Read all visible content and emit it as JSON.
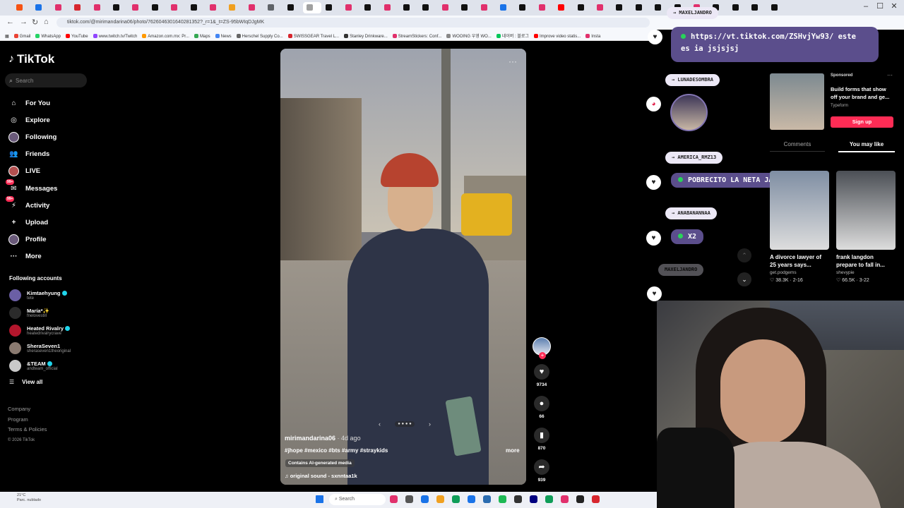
{
  "browser": {
    "tab_colors": [
      "#f65314",
      "#1a73e8",
      "#e1306c",
      "#d7262e",
      "#e1306c",
      "#111111",
      "#e1306c",
      "#111111",
      "#e1306c",
      "#111111",
      "#e1306c",
      "#f0a020",
      "#e1306c",
      "#5f6368",
      "#111111",
      "#a0a0a0",
      "#111111",
      "#e1306c",
      "#111111",
      "#e1306c",
      "#111111",
      "#111111",
      "#e1306c",
      "#111111",
      "#e1306c",
      "#1a73e8",
      "#111111",
      "#e1306c",
      "#ff0000",
      "#111111",
      "#e1306c",
      "#111111",
      "#111111",
      "#111111",
      "#111111",
      "#e1306c",
      "#111111",
      "#111111",
      "#111111",
      "#111111"
    ],
    "url": "tiktok.com/@mirimandarina06/photo/7626046301640281352?_r=1&_t=ZS-95bWIqDJgMK",
    "bookmarks": [
      {
        "label": "Gmail",
        "color": "#ea4335"
      },
      {
        "label": "WhatsApp",
        "color": "#25d366"
      },
      {
        "label": "YouTube",
        "color": "#ff0000"
      },
      {
        "label": "www.twitch.tv/Twitch",
        "color": "#9146ff"
      },
      {
        "label": "Amazon.com.mx: Pr...",
        "color": "#ff9900"
      },
      {
        "label": "Maps",
        "color": "#34a853"
      },
      {
        "label": "News",
        "color": "#4285f4"
      },
      {
        "label": "Herschel Supply Co...",
        "color": "#666666"
      },
      {
        "label": "SWISSGEAR Travel L...",
        "color": "#d7262e"
      },
      {
        "label": "Stanley Drinkware...",
        "color": "#333333"
      },
      {
        "label": "StreamStickers: Conf...",
        "color": "#e1306c"
      },
      {
        "label": "WOOING 우영 WO...",
        "color": "#888888"
      },
      {
        "label": "네이버 : 블로그",
        "color": "#03c75a"
      },
      {
        "label": "Improve video statis...",
        "color": "#ff0000"
      },
      {
        "label": "Insta",
        "color": "#e1306c"
      }
    ]
  },
  "sidebar": {
    "logo": "TikTok",
    "search_placeholder": "Search",
    "nav": [
      {
        "label": "For You",
        "icon": "home-icon",
        "glyph": "⌂"
      },
      {
        "label": "Explore",
        "icon": "compass-icon",
        "glyph": "◎"
      },
      {
        "label": "Following",
        "icon": "following-avatar",
        "glyph": ""
      },
      {
        "label": "Friends",
        "icon": "friends-icon",
        "glyph": "👥"
      },
      {
        "label": "LIVE",
        "icon": "live-avatar",
        "glyph": ""
      },
      {
        "label": "Messages",
        "icon": "messages-icon",
        "glyph": "✉",
        "badge": "99+"
      },
      {
        "label": "Activity",
        "icon": "activity-icon",
        "glyph": "⚡",
        "badge": "99+"
      },
      {
        "label": "Upload",
        "icon": "upload-icon",
        "glyph": "+"
      },
      {
        "label": "Profile",
        "icon": "profile-avatar",
        "glyph": ""
      },
      {
        "label": "More",
        "icon": "more-icon",
        "glyph": "···"
      }
    ],
    "following_title": "Following accounts",
    "following": [
      {
        "name": "Kimtaehyung",
        "handle": "tete",
        "verified": true,
        "color": "#6b5fa5"
      },
      {
        "name": "María*✨",
        "handle": "fnelovestill",
        "verified": false,
        "color": "#2b2b2b"
      },
      {
        "name": "Heated Rivalry",
        "handle": "heatedrivalrycrave",
        "verified": true,
        "color": "#b3162c"
      },
      {
        "name": "SheraSeven1",
        "handle": "sheraseven1theoriginal",
        "verified": false,
        "color": "#8a7a70"
      },
      {
        "name": "&TEAM",
        "handle": "andteam_official",
        "verified": true,
        "color": "#c9c9c9"
      }
    ],
    "view_all": "View all",
    "footer": [
      "Company",
      "Program",
      "Terms & Policies"
    ],
    "copyright": "© 2026 TikTok"
  },
  "video": {
    "author": "mirimandarina06",
    "age": "· 4d ago",
    "hashtags": "#jhope #mexico #bts #army #straykids",
    "more": "more",
    "ai_label": "Contains AI-generated media",
    "sound": "♫  original sound - sxnntaa1k",
    "menu": "···",
    "carousel_prev": "‹",
    "carousel_next": "›",
    "carousel_dots": "● ● ● ●"
  },
  "actions": {
    "likes": "9734",
    "comments": "66",
    "saves": "870",
    "shares": "939"
  },
  "chat": {
    "link_user": "→ MAXELJANDRO",
    "link_msg": "https://vt.tiktok.com/ZSHvjYw93/ este es ia jsjsjsj",
    "user1": "→ LUNADESOMBRA",
    "user2": "→ AMERICA_RMZ13",
    "msg2": "POBRECITO LA NETA JAJAJAJAJAJA",
    "user3": "→ ANABANANNAA",
    "msg3": "X2",
    "user4": "MAXELJANDRO"
  },
  "right_panel": {
    "sponsored": "Sponsored",
    "ad_text": "Build forms that show off your brand and ge...",
    "ad_brand": "Typeform",
    "signup": "Sign up",
    "tab_comments": "Comments",
    "tab_may_like": "You may like",
    "recs": [
      {
        "title": "A divorce lawyer of 25 years says...",
        "user": "get.podgems",
        "stats": "♡ 38.3K · 2-16",
        "color": "#7f8ea3"
      },
      {
        "title": "frank langdon prepare to fall in...",
        "user": "shevypie",
        "stats": "♡ 66.5K · 3-22",
        "color": "#4b4f55"
      }
    ]
  },
  "taskbar": {
    "temp": "21°C",
    "weather": "Parc. nublado",
    "search": "Search",
    "icon_colors": [
      "#e1306c",
      "#555555",
      "#1a73e8",
      "#f0a020",
      "#0f9d58",
      "#1a73e8",
      "#2b6cb0",
      "#1db954",
      "#333333",
      "#000080",
      "#0f9d58",
      "#e1306c",
      "#222222",
      "#d7262e"
    ]
  }
}
